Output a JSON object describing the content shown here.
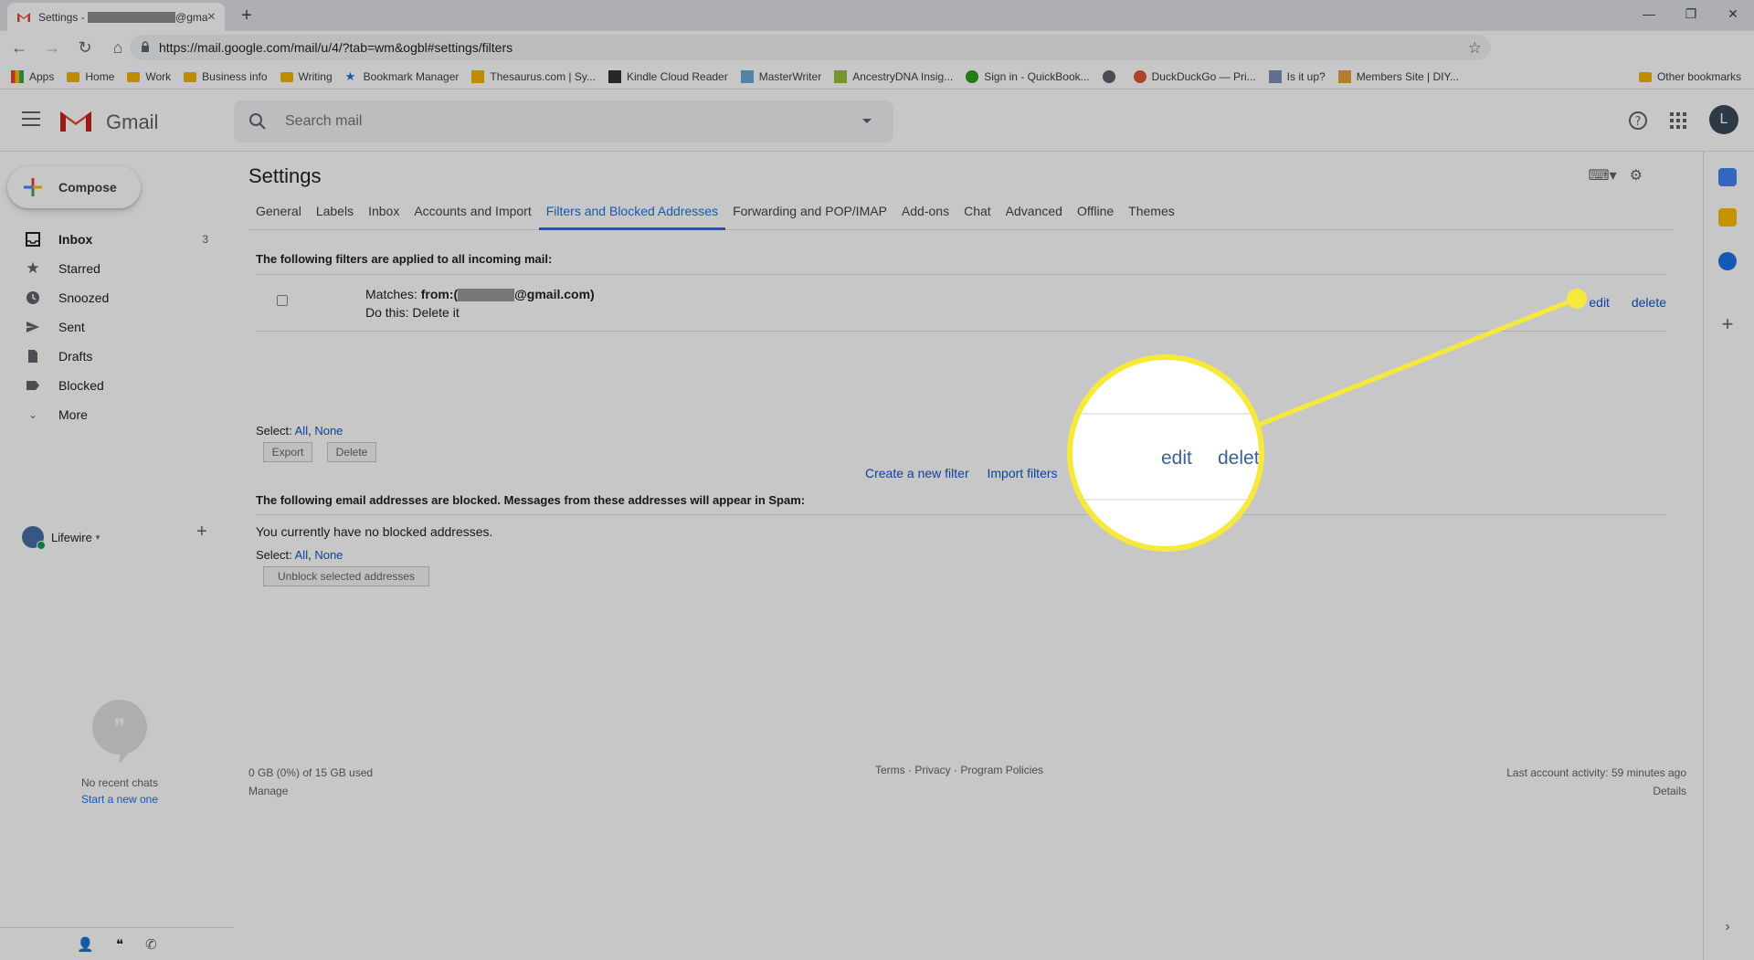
{
  "browser": {
    "tab_title_prefix": "Settings - ",
    "tab_title_suffix": "@gmail.c",
    "url": "https://mail.google.com/mail/u/4/?tab=wm&ogbl#settings/filters",
    "bookmarks": [
      {
        "label": "Apps",
        "icon": "apps-grid-icon"
      },
      {
        "label": "Home",
        "icon": "folder-icon"
      },
      {
        "label": "Work",
        "icon": "folder-icon"
      },
      {
        "label": "Business info",
        "icon": "folder-icon"
      },
      {
        "label": "Writing",
        "icon": "folder-icon"
      },
      {
        "label": "Bookmark Manager",
        "icon": "star-icon"
      },
      {
        "label": "Thesaurus.com | Sy...",
        "icon": "thesaurus-icon"
      },
      {
        "label": "Kindle Cloud Reader",
        "icon": "kindle-icon"
      },
      {
        "label": "MasterWriter",
        "icon": "masterwriter-icon"
      },
      {
        "label": "AncestryDNA Insig...",
        "icon": "ancestry-icon"
      },
      {
        "label": "Sign in - QuickBook...",
        "icon": "quickbooks-icon"
      },
      {
        "label": "",
        "icon": "globe-icon"
      },
      {
        "label": "DuckDuckGo — Pri...",
        "icon": "duckduckgo-icon"
      },
      {
        "label": "Is it up?",
        "icon": "wrench-icon"
      },
      {
        "label": "Members Site | DIY...",
        "icon": "members-icon"
      }
    ],
    "other_bookmarks": "Other bookmarks"
  },
  "header": {
    "app_name": "Gmail",
    "search_placeholder": "Search mail",
    "avatar_letter": "L"
  },
  "sidebar": {
    "compose": "Compose",
    "items": [
      {
        "label": "Inbox",
        "count": "3",
        "icon": "inbox-icon"
      },
      {
        "label": "Starred",
        "count": "",
        "icon": "star-icon"
      },
      {
        "label": "Snoozed",
        "count": "",
        "icon": "clock-icon"
      },
      {
        "label": "Sent",
        "count": "",
        "icon": "send-icon"
      },
      {
        "label": "Drafts",
        "count": "",
        "icon": "draft-icon"
      },
      {
        "label": "Blocked",
        "count": "",
        "icon": "label-icon"
      },
      {
        "label": "More",
        "count": "",
        "icon": "chevron-down-icon"
      }
    ],
    "hangouts_user": "Lifewire",
    "no_chats": "No recent chats",
    "start_new": "Start a new one"
  },
  "settings": {
    "title": "Settings",
    "tabs": [
      "General",
      "Labels",
      "Inbox",
      "Accounts and Import",
      "Filters and Blocked Addresses",
      "Forwarding and POP/IMAP",
      "Add-ons",
      "Chat",
      "Advanced",
      "Offline",
      "Themes"
    ],
    "active_tab": "Filters and Blocked Addresses",
    "filters_heading": "The following filters are applied to all incoming mail:",
    "filter": {
      "matches_label": "Matches: ",
      "from_prefix": "from:(",
      "from_suffix": "@gmail.com)",
      "action": "Do this: Delete it",
      "edit": "edit",
      "delete": "delete"
    },
    "select_label": "Select: ",
    "select_all": "All",
    "select_none": "None",
    "export_btn": "Export",
    "delete_btn": "Delete",
    "create_filter": "Create a new filter",
    "import_filters": "Import filters",
    "blocked_heading": "The following email addresses are blocked. Messages from these addresses will appear in Spam:",
    "no_blocked": "You currently have no blocked addresses.",
    "unblock_btn": "Unblock selected addresses"
  },
  "footer": {
    "storage": "0 GB (0%) of 15 GB used",
    "manage": "Manage",
    "terms": "Terms",
    "privacy": "Privacy",
    "program_policies": "Program Policies",
    "last_activity": "Last account activity: 59 minutes ago",
    "details": "Details"
  },
  "callout": {
    "edit": "edit",
    "delete_partial": "delet",
    "color": "#f7e93c"
  },
  "colors": {
    "link": "#1155cc",
    "accent": "#1a73e8",
    "gmail_red": "#ea4335"
  }
}
